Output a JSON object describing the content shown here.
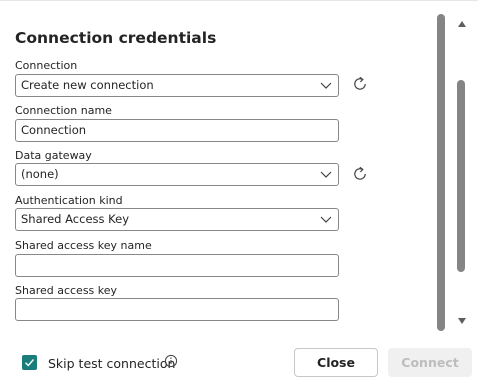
{
  "dialog": {
    "title": "Connection credentials"
  },
  "fields": {
    "connection": {
      "label": "Connection",
      "value": "Create new connection"
    },
    "connection_name": {
      "label": "Connection name",
      "value": "Connection"
    },
    "data_gateway": {
      "label": "Data gateway",
      "value": "(none)"
    },
    "authentication_kind": {
      "label": "Authentication kind",
      "value": "Shared Access Key"
    },
    "shared_access_key_name": {
      "label": "Shared access key name",
      "value": ""
    },
    "shared_access_key": {
      "label": "Shared access key",
      "value": ""
    }
  },
  "footer": {
    "skip_test_label": "Skip test connection",
    "skip_test_checked": true,
    "close_label": "Close",
    "connect_label": "Connect"
  },
  "colors": {
    "accent": "#1b7c7c",
    "border": "#8a8886",
    "disabled_text": "#bdbdbd"
  }
}
